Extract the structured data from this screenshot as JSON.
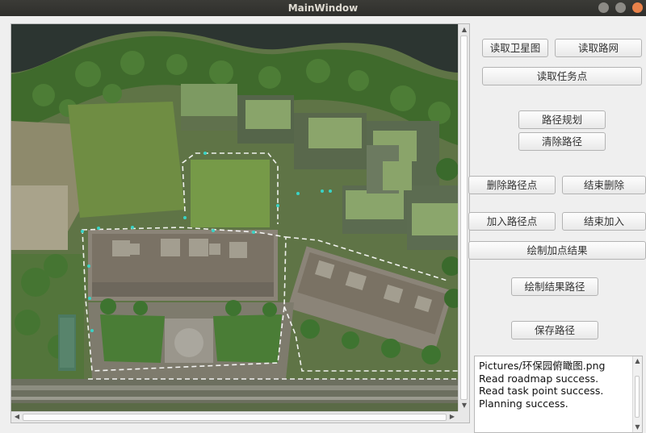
{
  "window": {
    "title": "MainWindow"
  },
  "icons": {
    "minimize": "minimize-dot-icon",
    "maximize": "maximize-dot-icon",
    "close": "close-dot-icon"
  },
  "colors": {
    "close": "#e9824a",
    "titlebar": "#2f2f2c",
    "window_bg": "#efefef"
  },
  "buttons": {
    "load_satellite": "读取卫星图",
    "load_roadnet": "读取路网",
    "load_tasks": "读取任务点",
    "plan_path": "路径规划",
    "clear_path": "清除路径",
    "delete_points": "删除路径点",
    "end_delete": "结束删除",
    "add_points": "加入路径点",
    "end_add": "结束加入",
    "draw_added_result": "绘制加点结果",
    "draw_result_path": "绘制结果路径",
    "save_path": "保存路径"
  },
  "log": {
    "lines": [
      "Pictures/环保园俯瞰图.png",
      "Read roadmap success.",
      "Read task point success.",
      "Planning success."
    ]
  }
}
